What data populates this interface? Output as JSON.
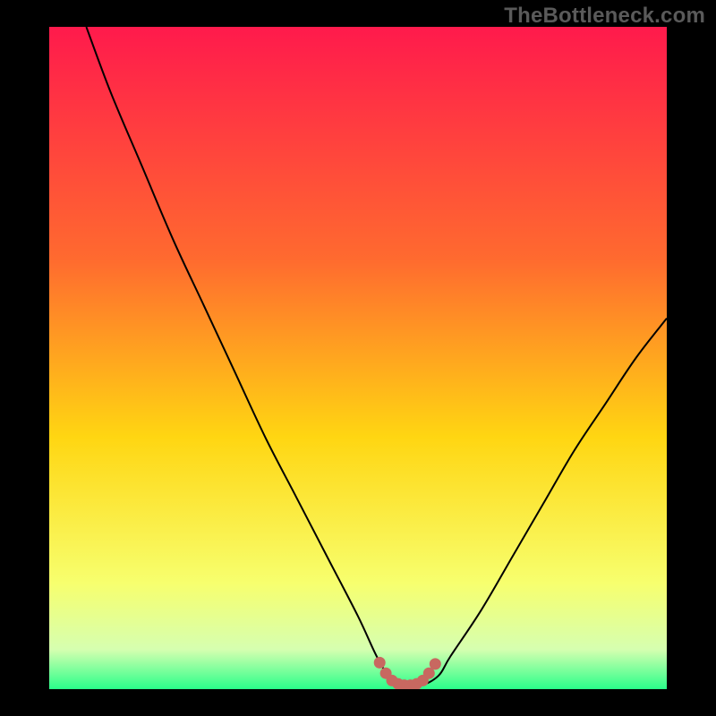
{
  "watermark": "TheBottleneck.com",
  "colors": {
    "bg": "#000000",
    "grad_top": "#ff1a4c",
    "grad_mid1": "#ff6a2f",
    "grad_mid2": "#ffd612",
    "grad_low1": "#f7ff6e",
    "grad_low2": "#d6ffb0",
    "grad_bottom": "#2aff8a",
    "curve": "#000000",
    "optimum": "#c86860"
  },
  "chart_data": {
    "type": "line",
    "title": "",
    "xlabel": "",
    "ylabel": "",
    "xlim": [
      0,
      100
    ],
    "ylim": [
      0,
      100
    ],
    "series": [
      {
        "name": "bottleneck-curve",
        "x": [
          6,
          10,
          15,
          20,
          25,
          30,
          35,
          40,
          45,
          50,
          53,
          55,
          57,
          60,
          63,
          65,
          70,
          75,
          80,
          85,
          90,
          95,
          100
        ],
        "y": [
          100,
          90,
          79,
          68,
          58,
          48,
          38,
          29,
          20,
          11,
          5,
          2,
          0.5,
          0.5,
          2,
          5,
          12,
          20,
          28,
          36,
          43,
          50,
          56
        ]
      },
      {
        "name": "optimum-band",
        "x": [
          53.5,
          54.5,
          55.5,
          56.5,
          57.5,
          58.5,
          59.5,
          60.5,
          61.5,
          62.5
        ],
        "y": [
          4.0,
          2.4,
          1.3,
          0.8,
          0.6,
          0.6,
          0.8,
          1.3,
          2.4,
          3.8
        ]
      }
    ],
    "annotations": []
  }
}
